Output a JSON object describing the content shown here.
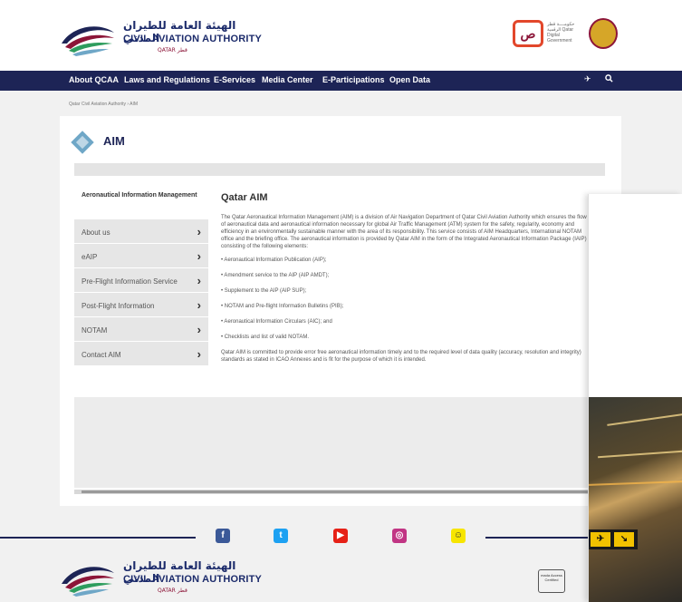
{
  "header": {
    "logo_ar": "الهيئة العامة للطيران المدني",
    "logo_en": "CIVIL AVIATION AUTHORITY",
    "logo_qatar": "QATAR قطر",
    "digital_gov_badge": "ص",
    "digital_gov_text": "حكومــــة قطر الرقمية Qatar Digital Government"
  },
  "nav": {
    "items": [
      "About QCAA",
      "Laws and Regulations",
      "E-Services",
      "Media Center",
      "E-Participations",
      "Open Data"
    ],
    "icons": [
      "plane-icon",
      "search-icon"
    ]
  },
  "breadcrumb": "Qatar Civil Aviation Authority › AIM",
  "page": {
    "title": "AIM",
    "sidebar_heading": "Aeronautical Information Management",
    "sidebar_items": [
      "About us",
      "eAIP",
      "Pre-Flight Information Service",
      "Post-Flight Information",
      "NOTAM",
      "Contact AIM"
    ],
    "content_title": "Qatar AIM",
    "intro": "The Qatar Aeronautical Information Management (AIM) is a division of Air Navigation Department of Qatar Civil Aviation Authority which ensures the flow of aeronautical data and aeronautical information necessary for global Air Traffic Management (ATM) system for the safety, regularity, economy and efficiency in an environmentally sustainable manner with the area of its responsibility. This service consists of AIM Headquarters, International NOTAM office and the briefing office. The aeronautical information is provided by Qatar AIM in the form of the Integrated Aeronautical Information Package (IAIP) consisting of the following elements:",
    "elements": [
      "• Aeronautical Information Publication (AIP);",
      "• Amendment service to the AIP (AIP AMDT);",
      "• Supplement to the AIP (AIP SUP);",
      "• NOTAM and Pre-flight Information Bulletins (PIB);",
      "• Aeronautical Information Circulars (AIC); and",
      "• Checklists and list of valid NOTAM."
    ],
    "closing": "Qatar AIM is committed to provide error free aeronautical information timely and to the required level of data quality (accuracy, resolution and integrity) standards as stated in ICAO Annexes and is fit for the purpose of which it is intended."
  },
  "footer": {
    "social": [
      "facebook-icon",
      "twitter-icon",
      "youtube-icon",
      "instagram-icon",
      "snapchat-icon"
    ],
    "social_glyphs": [
      "f",
      "t",
      "▶",
      "◎",
      "☺"
    ],
    "social_colors": [
      "#3b5998",
      "#1da1f2",
      "#e62117",
      "#c13584",
      "#f7e500"
    ],
    "access_badge": "mada Access Certified"
  },
  "overlay": {
    "sign_glyphs": [
      "✈",
      "↘"
    ]
  },
  "colors": {
    "nav_bg": "#1d2456",
    "brand_maroon": "#8c1538",
    "accent_blue": "#6fa7c7"
  }
}
